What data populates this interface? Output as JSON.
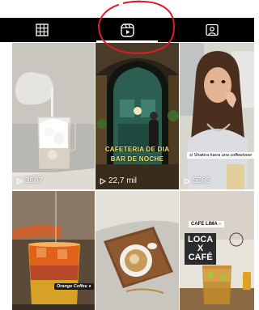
{
  "tabs": [
    {
      "icon": "grid-icon",
      "active": false
    },
    {
      "icon": "reels-icon",
      "active": true
    },
    {
      "icon": "tagged-icon",
      "active": false
    }
  ],
  "tiles": [
    {
      "views": "3667"
    },
    {
      "views": "22,7 mil",
      "overlay_line1": "CAFETERIA DE DIA",
      "overlay_line2": "BAR DE NOCHE"
    },
    {
      "views": "5085",
      "caption": "si Shakira fuera una coffeelover"
    },
    {
      "caption": "Orange Coffee"
    },
    {},
    {
      "label": "CAFE LIMA",
      "sign_line1": "LOCA",
      "sign_line2": "X",
      "sign_line3": "CAFÉ"
    }
  ],
  "annotation_color": "#d91e2e"
}
